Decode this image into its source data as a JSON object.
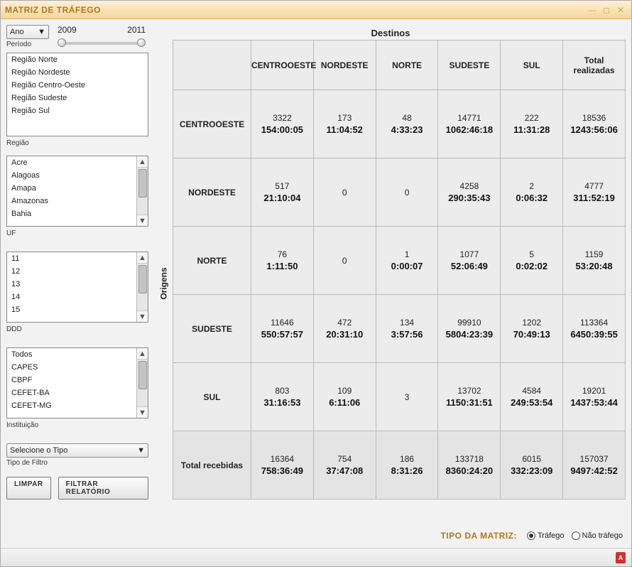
{
  "window": {
    "title": "MATRIZ DE TRÁFEGO",
    "minimize_icon": "minimize-icon",
    "maximize_icon": "maximize-icon",
    "close_icon": "close-icon"
  },
  "period": {
    "grouping_label": "Ano",
    "grouping_caption": "Período",
    "year_min": "2009",
    "year_max": "2011"
  },
  "region": {
    "caption": "Região",
    "items": [
      "Região Norte",
      "Região Nordeste",
      "Região Centro-Oeste",
      "Região Sudeste",
      "Região Sul"
    ]
  },
  "uf": {
    "caption": "UF",
    "items": [
      "Acre",
      "Alagoas",
      "Amapa",
      "Amazonas",
      "Bahia"
    ]
  },
  "ddd": {
    "caption": "DDD",
    "items": [
      "11",
      "12",
      "13",
      "14",
      "15"
    ]
  },
  "institution": {
    "caption": "Instituição",
    "items": [
      "Todos",
      "CAPES",
      "CBPF",
      "CEFET-BA",
      "CEFET-MG"
    ]
  },
  "filter_type": {
    "select_label": "Selecione o Tipo",
    "caption": "Tipo de Filtro"
  },
  "buttons": {
    "clear": "LIMPAR",
    "filter": "FILTRAR RELATÓRIO"
  },
  "matrix": {
    "destinations_label": "Destinos",
    "origins_label": "Origens",
    "type_label": "TIPO DA MATRIZ:",
    "radio_traffic": "Tráfego",
    "radio_nontraffic": "Não tráfego",
    "col_headers": [
      "CENTROOESTE",
      "NORDESTE",
      "NORTE",
      "SUDESTE",
      "SUL",
      "Total realizadas"
    ],
    "row_headers": [
      "CENTROOESTE",
      "NORDESTE",
      "NORTE",
      "SUDESTE",
      "SUL",
      "Total recebidas"
    ],
    "cells": [
      [
        {
          "count": "3322",
          "dur": "154:00:05"
        },
        {
          "count": "173",
          "dur": "11:04:52"
        },
        {
          "count": "48",
          "dur": "4:33:23"
        },
        {
          "count": "14771",
          "dur": "1062:46:18"
        },
        {
          "count": "222",
          "dur": "11:31:28"
        },
        {
          "count": "18536",
          "dur": "1243:56:06"
        }
      ],
      [
        {
          "count": "517",
          "dur": "21:10:04"
        },
        {
          "count": "0",
          "dur": ""
        },
        {
          "count": "0",
          "dur": ""
        },
        {
          "count": "4258",
          "dur": "290:35:43"
        },
        {
          "count": "2",
          "dur": "0:06:32"
        },
        {
          "count": "4777",
          "dur": "311:52:19"
        }
      ],
      [
        {
          "count": "76",
          "dur": "1:11:50"
        },
        {
          "count": "0",
          "dur": ""
        },
        {
          "count": "1",
          "dur": "0:00:07"
        },
        {
          "count": "1077",
          "dur": "52:06:49"
        },
        {
          "count": "5",
          "dur": "0:02:02"
        },
        {
          "count": "1159",
          "dur": "53:20:48"
        }
      ],
      [
        {
          "count": "11646",
          "dur": "550:57:57"
        },
        {
          "count": "472",
          "dur": "20:31:10"
        },
        {
          "count": "134",
          "dur": "3:57:56"
        },
        {
          "count": "99910",
          "dur": "5804:23:39"
        },
        {
          "count": "1202",
          "dur": "70:49:13"
        },
        {
          "count": "113364",
          "dur": "6450:39:55"
        }
      ],
      [
        {
          "count": "803",
          "dur": "31:16:53"
        },
        {
          "count": "109",
          "dur": "6:11:06"
        },
        {
          "count": "3",
          "dur": ""
        },
        {
          "count": "13702",
          "dur": "1150:31:51"
        },
        {
          "count": "4584",
          "dur": "249:53:54"
        },
        {
          "count": "19201",
          "dur": "1437:53:44"
        }
      ],
      [
        {
          "count": "16364",
          "dur": "758:36:49"
        },
        {
          "count": "754",
          "dur": "37:47:08"
        },
        {
          "count": "186",
          "dur": "8:31:26"
        },
        {
          "count": "133718",
          "dur": "8360:24:20"
        },
        {
          "count": "6015",
          "dur": "332:23:09"
        },
        {
          "count": "157037",
          "dur": "9497:42:52"
        }
      ]
    ]
  },
  "status": {
    "pdf_label": "A"
  }
}
